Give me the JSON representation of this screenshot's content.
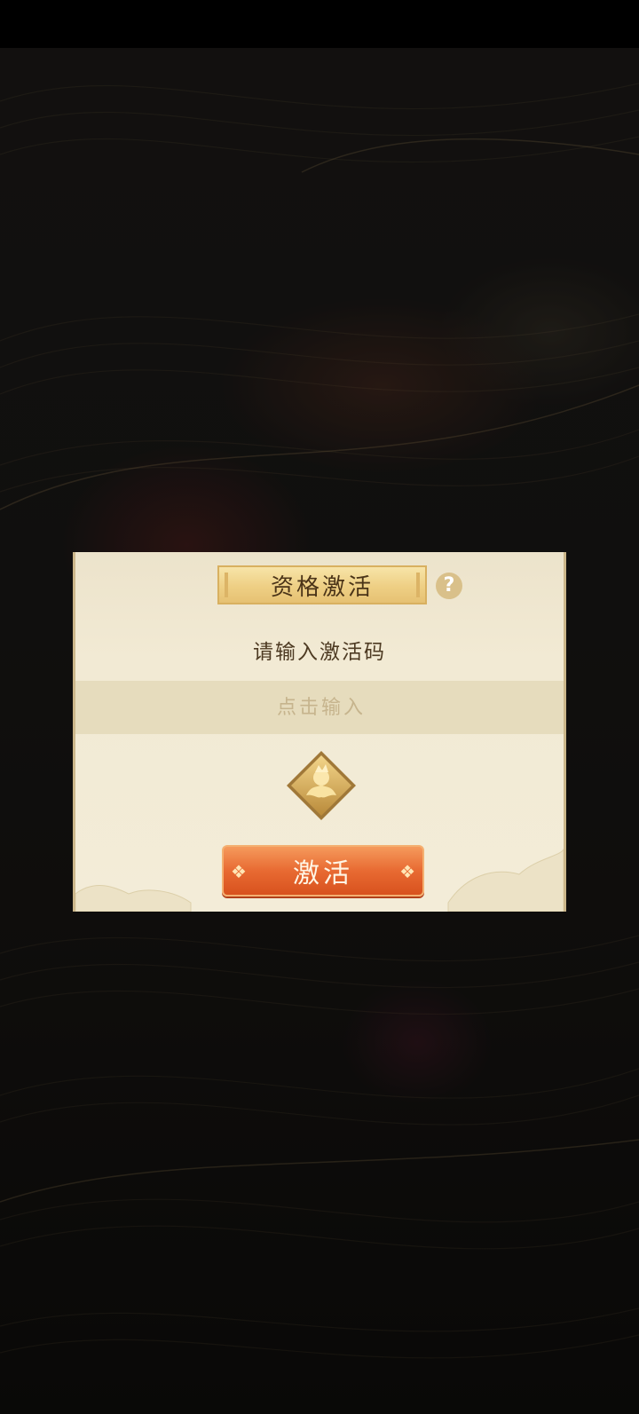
{
  "dialog": {
    "title": "资格激活",
    "help_symbol": "?",
    "prompt": "请输入激活码",
    "input_placeholder": "点击输入",
    "input_value": "",
    "activate_label": "激活",
    "button_deco": "❖"
  },
  "icons": {
    "help": "question-mark-icon",
    "emblem": "golden-emblem-icon"
  },
  "colors": {
    "panel": "#f3ecd8",
    "title_plate": "#eecf84",
    "button": "#e86a32",
    "text_dark": "#4b3418",
    "placeholder": "#c6b48d"
  }
}
